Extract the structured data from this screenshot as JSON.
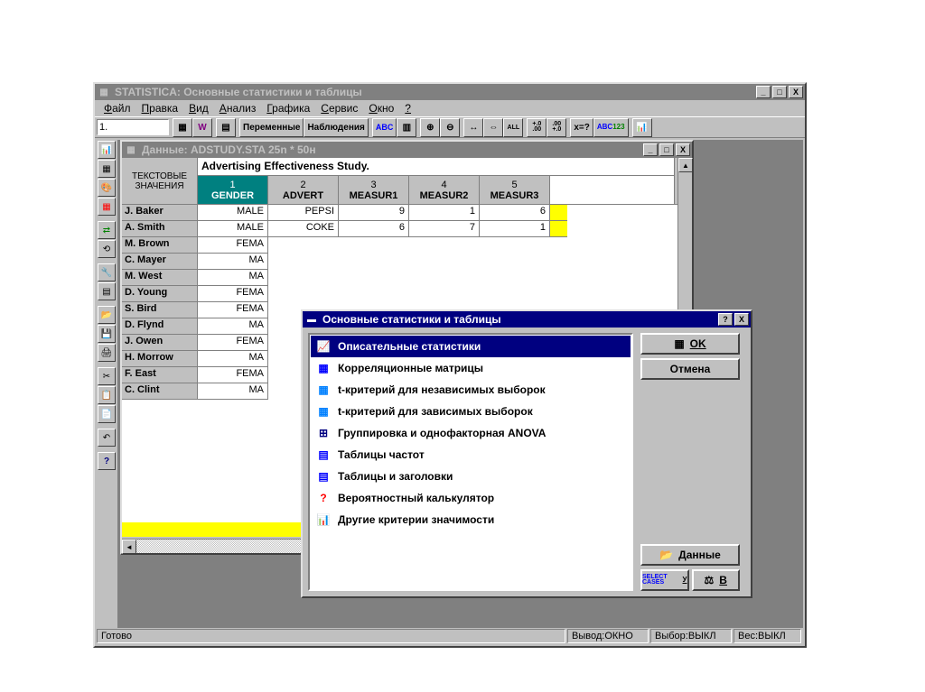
{
  "app": {
    "title": "STATISTICA: Основные статистики и таблицы",
    "menu": [
      "Файл",
      "Правка",
      "Вид",
      "Анализ",
      "Графика",
      "Сервис",
      "Окно",
      "?"
    ],
    "input_value": "1.",
    "toolbar_text": {
      "vars": "Переменные",
      "obs": "Наблюдения",
      "abc": "ABC",
      "calc": "x=?",
      "fmt": "ABC 123"
    }
  },
  "sidebar": {
    "icons": [
      "chart",
      "vars",
      "palette",
      "grid",
      "select",
      "replace",
      "toolbox",
      "grid2",
      "open",
      "save",
      "print",
      "cut",
      "copy",
      "paste",
      "undo",
      "help"
    ]
  },
  "datawin": {
    "title": "Данные: ADSTUDY.STA 25n * 50н",
    "topleft_l1": "ТЕКСТОВЫЕ",
    "topleft_l2": "ЗНАЧЕНИЯ",
    "description": "Advertising Effectiveness Study.",
    "columns": [
      {
        "n": "1",
        "name": "GENDER"
      },
      {
        "n": "2",
        "name": "ADVERT"
      },
      {
        "n": "3",
        "name": "MEASUR1"
      },
      {
        "n": "4",
        "name": "MEASUR2"
      },
      {
        "n": "5",
        "name": "MEASUR3"
      }
    ],
    "rows": [
      {
        "name": "J. Baker",
        "c": [
          "MALE",
          "PEPSI",
          "9",
          "1",
          "6"
        ]
      },
      {
        "name": "A. Smith",
        "c": [
          "MALE",
          "COKE",
          "6",
          "7",
          "1"
        ]
      },
      {
        "name": "M. Brown",
        "c": [
          "FEMA",
          "",
          "",
          "",
          ""
        ]
      },
      {
        "name": "C. Mayer",
        "c": [
          "MA",
          "",
          "",
          "",
          ""
        ]
      },
      {
        "name": "M. West",
        "c": [
          "MA",
          "",
          "",
          "",
          ""
        ]
      },
      {
        "name": "D. Young",
        "c": [
          "FEMA",
          "",
          "",
          "",
          ""
        ]
      },
      {
        "name": "S. Bird",
        "c": [
          "FEMA",
          "",
          "",
          "",
          ""
        ]
      },
      {
        "name": "D. Flynd",
        "c": [
          "MA",
          "",
          "",
          "",
          ""
        ]
      },
      {
        "name": "J. Owen",
        "c": [
          "FEMA",
          "",
          "",
          "",
          ""
        ]
      },
      {
        "name": "H. Morrow",
        "c": [
          "MA",
          "",
          "",
          "",
          ""
        ]
      },
      {
        "name": "F. East",
        "c": [
          "FEMA",
          "",
          "",
          "",
          ""
        ]
      },
      {
        "name": "C. Clint",
        "c": [
          "MA",
          "",
          "",
          "",
          ""
        ]
      }
    ]
  },
  "dialog": {
    "title": "Основные статистики и таблицы",
    "items": [
      "Описательные статистики",
      "Корреляционные матрицы",
      "t-критерий для независимых выборок",
      "t-критерий для зависимых выборок",
      "Группировка и однофакторная ANOVA",
      "Таблицы частот",
      "Таблицы и заголовки",
      "Вероятностный калькулятор",
      "Другие критерии значимости"
    ],
    "buttons": {
      "ok": "OK",
      "cancel": "Отмена",
      "data": "Данные",
      "select": "У",
      "b": "В",
      "select_cases": "SELECT CASES"
    }
  },
  "status": {
    "ready": "Готово",
    "out": "Вывод:ОКНО",
    "sel": "Выбор:ВЫКЛ",
    "wgt": "Вес:ВЫКЛ"
  }
}
